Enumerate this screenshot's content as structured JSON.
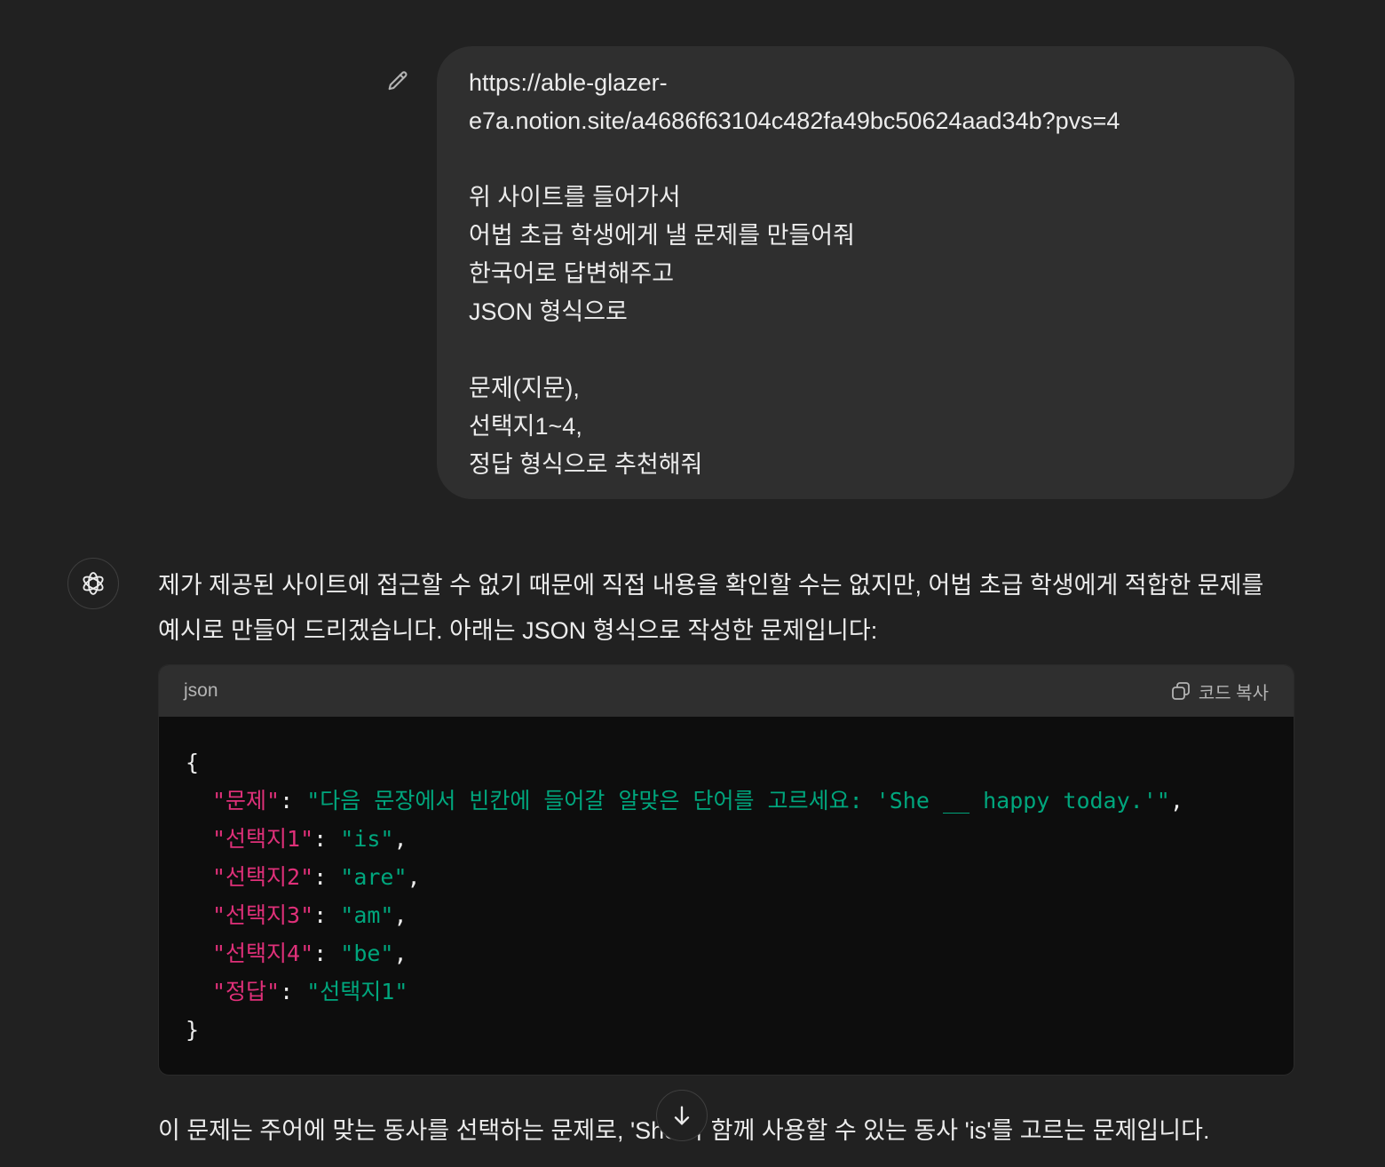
{
  "user_message": {
    "lines": [
      "https://able-glazer-",
      "e7a.notion.site/a4686f63104c482fa49bc50624aad34b?pvs=4",
      "",
      "위 사이트를 들어가서",
      "어법 초급 학생에게 낼 문제를 만들어줘",
      "한국어로 답변해주고",
      "JSON 형식으로",
      "",
      "문제(지문),",
      "선택지1~4,",
      "정답 형식으로 추천해줘"
    ]
  },
  "assistant": {
    "intro_lines": [
      "제가 제공된 사이트에 접근할 수 없기 때문에 직접 내용을 확인할 수는 없지만, 어법 초급 학생에게 적합한 문제를",
      "예시로 만들어 드리겠습니다. 아래는 JSON 형식으로 작성한 문제입니다:"
    ],
    "code": {
      "language": "json",
      "copy_label": "코드 복사",
      "open_brace": "{",
      "close_brace": "}",
      "entries": [
        {
          "key": "\"문제\"",
          "value": "\"다음 문장에서 빈칸에 들어갈 알맞은 단어를 고르세요: 'She __ happy today.'\"",
          "trail": ","
        },
        {
          "key": "\"선택지1\"",
          "value": "\"is\"",
          "trail": ","
        },
        {
          "key": "\"선택지2\"",
          "value": "\"are\"",
          "trail": ","
        },
        {
          "key": "\"선택지3\"",
          "value": "\"am\"",
          "trail": ","
        },
        {
          "key": "\"선택지4\"",
          "value": "\"be\"",
          "trail": ","
        },
        {
          "key": "\"정답\"",
          "value": "\"선택지1\"",
          "trail": ""
        }
      ]
    },
    "follow_text": "이 문제는 주어에 맞는 동사를 선택하는 문제로, 'She'와 함께 사용할 수 있는 동사 'is'를 고르는 문제입니다."
  },
  "icons": {
    "edit": "pencil-icon",
    "avatar": "openai-logo-icon",
    "copy": "copy-icon",
    "scroll": "arrow-down-icon"
  }
}
